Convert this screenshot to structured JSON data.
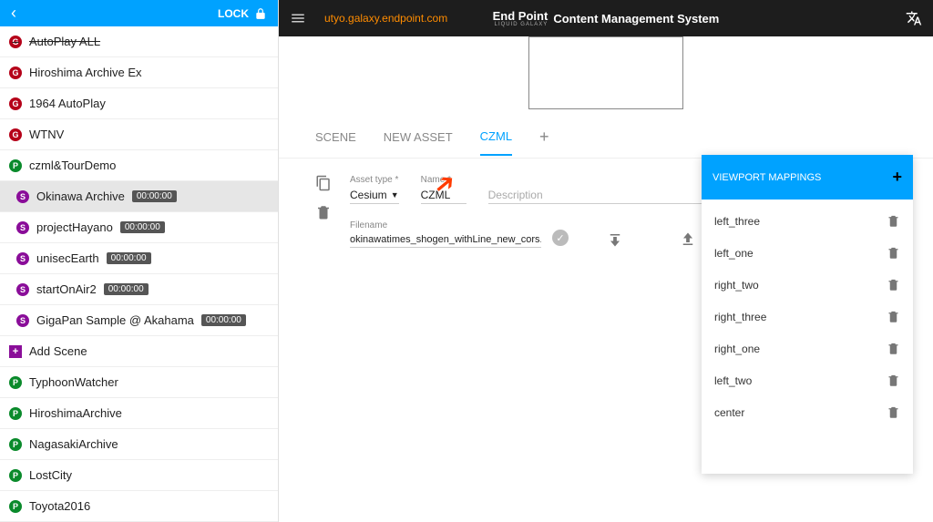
{
  "header": {
    "lock_label": "LOCK"
  },
  "sidebar_items": [
    {
      "icon": "g",
      "char": "G",
      "label": "AutoPlay ALL",
      "strike": true
    },
    {
      "icon": "g",
      "char": "G",
      "label": "Hiroshima Archive Ex"
    },
    {
      "icon": "g",
      "char": "G",
      "label": "1964 AutoPlay"
    },
    {
      "icon": "g",
      "char": "G",
      "label": "WTNV"
    },
    {
      "icon": "p",
      "char": "P",
      "label": "czml&TourDemo"
    },
    {
      "icon": "s",
      "char": "S",
      "label": "Okinawa Archive",
      "badge": "00:00:00",
      "sub": true,
      "selected": true
    },
    {
      "icon": "s",
      "char": "S",
      "label": "projectHayano",
      "badge": "00:00:00",
      "sub": true
    },
    {
      "icon": "s",
      "char": "S",
      "label": "unisecEarth",
      "badge": "00:00:00",
      "sub": true
    },
    {
      "icon": "s",
      "char": "S",
      "label": "startOnAir2",
      "badge": "00:00:00",
      "sub": true
    },
    {
      "icon": "s",
      "char": "S",
      "label": "GigaPan Sample @ Akahama",
      "badge": "00:00:00",
      "sub": true
    },
    {
      "icon": "plus",
      "char": "+",
      "label": "Add Scene"
    },
    {
      "icon": "p",
      "char": "P",
      "label": "TyphoonWatcher"
    },
    {
      "icon": "p",
      "char": "P",
      "label": "HiroshimaArchive"
    },
    {
      "icon": "p",
      "char": "P",
      "label": "NagasakiArchive"
    },
    {
      "icon": "p",
      "char": "P",
      "label": "LostCity"
    },
    {
      "icon": "p",
      "char": "P",
      "label": "Toyota2016"
    }
  ],
  "topbar": {
    "host": "utyo.galaxy.endpoint.com",
    "brand_ep": "End Point",
    "brand_lg": "LIQUID GALAXY",
    "brand_cms": "Content Management System"
  },
  "tabs": {
    "scene": "SCENE",
    "new_asset": "NEW ASSET",
    "czml": "CZML"
  },
  "fields": {
    "asset_type_label": "Asset type *",
    "asset_type_value": "Cesium",
    "name_label": "Name *",
    "name_value": "CZML",
    "description_ph": "Description",
    "filename_label": "Filename",
    "filename_value": "okinawatimes_shogen_withLine_new_cors.czml"
  },
  "viewport": {
    "title": "VIEWPORT MAPPINGS",
    "items": [
      "left_three",
      "left_one",
      "right_two",
      "right_three",
      "right_one",
      "left_two",
      "center"
    ]
  }
}
